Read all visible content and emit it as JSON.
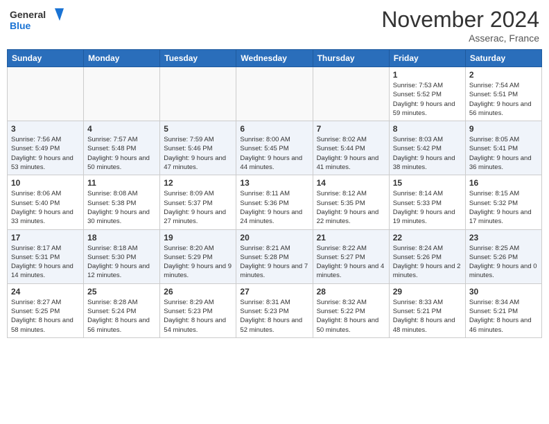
{
  "header": {
    "logo_line1": "General",
    "logo_line2": "Blue",
    "month": "November 2024",
    "location": "Asserac, France"
  },
  "weekdays": [
    "Sunday",
    "Monday",
    "Tuesday",
    "Wednesday",
    "Thursday",
    "Friday",
    "Saturday"
  ],
  "weeks": [
    [
      {
        "day": "",
        "info": ""
      },
      {
        "day": "",
        "info": ""
      },
      {
        "day": "",
        "info": ""
      },
      {
        "day": "",
        "info": ""
      },
      {
        "day": "",
        "info": ""
      },
      {
        "day": "1",
        "info": "Sunrise: 7:53 AM\nSunset: 5:52 PM\nDaylight: 9 hours and 59 minutes."
      },
      {
        "day": "2",
        "info": "Sunrise: 7:54 AM\nSunset: 5:51 PM\nDaylight: 9 hours and 56 minutes."
      }
    ],
    [
      {
        "day": "3",
        "info": "Sunrise: 7:56 AM\nSunset: 5:49 PM\nDaylight: 9 hours and 53 minutes."
      },
      {
        "day": "4",
        "info": "Sunrise: 7:57 AM\nSunset: 5:48 PM\nDaylight: 9 hours and 50 minutes."
      },
      {
        "day": "5",
        "info": "Sunrise: 7:59 AM\nSunset: 5:46 PM\nDaylight: 9 hours and 47 minutes."
      },
      {
        "day": "6",
        "info": "Sunrise: 8:00 AM\nSunset: 5:45 PM\nDaylight: 9 hours and 44 minutes."
      },
      {
        "day": "7",
        "info": "Sunrise: 8:02 AM\nSunset: 5:44 PM\nDaylight: 9 hours and 41 minutes."
      },
      {
        "day": "8",
        "info": "Sunrise: 8:03 AM\nSunset: 5:42 PM\nDaylight: 9 hours and 38 minutes."
      },
      {
        "day": "9",
        "info": "Sunrise: 8:05 AM\nSunset: 5:41 PM\nDaylight: 9 hours and 36 minutes."
      }
    ],
    [
      {
        "day": "10",
        "info": "Sunrise: 8:06 AM\nSunset: 5:40 PM\nDaylight: 9 hours and 33 minutes."
      },
      {
        "day": "11",
        "info": "Sunrise: 8:08 AM\nSunset: 5:38 PM\nDaylight: 9 hours and 30 minutes."
      },
      {
        "day": "12",
        "info": "Sunrise: 8:09 AM\nSunset: 5:37 PM\nDaylight: 9 hours and 27 minutes."
      },
      {
        "day": "13",
        "info": "Sunrise: 8:11 AM\nSunset: 5:36 PM\nDaylight: 9 hours and 24 minutes."
      },
      {
        "day": "14",
        "info": "Sunrise: 8:12 AM\nSunset: 5:35 PM\nDaylight: 9 hours and 22 minutes."
      },
      {
        "day": "15",
        "info": "Sunrise: 8:14 AM\nSunset: 5:33 PM\nDaylight: 9 hours and 19 minutes."
      },
      {
        "day": "16",
        "info": "Sunrise: 8:15 AM\nSunset: 5:32 PM\nDaylight: 9 hours and 17 minutes."
      }
    ],
    [
      {
        "day": "17",
        "info": "Sunrise: 8:17 AM\nSunset: 5:31 PM\nDaylight: 9 hours and 14 minutes."
      },
      {
        "day": "18",
        "info": "Sunrise: 8:18 AM\nSunset: 5:30 PM\nDaylight: 9 hours and 12 minutes."
      },
      {
        "day": "19",
        "info": "Sunrise: 8:20 AM\nSunset: 5:29 PM\nDaylight: 9 hours and 9 minutes."
      },
      {
        "day": "20",
        "info": "Sunrise: 8:21 AM\nSunset: 5:28 PM\nDaylight: 9 hours and 7 minutes."
      },
      {
        "day": "21",
        "info": "Sunrise: 8:22 AM\nSunset: 5:27 PM\nDaylight: 9 hours and 4 minutes."
      },
      {
        "day": "22",
        "info": "Sunrise: 8:24 AM\nSunset: 5:26 PM\nDaylight: 9 hours and 2 minutes."
      },
      {
        "day": "23",
        "info": "Sunrise: 8:25 AM\nSunset: 5:26 PM\nDaylight: 9 hours and 0 minutes."
      }
    ],
    [
      {
        "day": "24",
        "info": "Sunrise: 8:27 AM\nSunset: 5:25 PM\nDaylight: 8 hours and 58 minutes."
      },
      {
        "day": "25",
        "info": "Sunrise: 8:28 AM\nSunset: 5:24 PM\nDaylight: 8 hours and 56 minutes."
      },
      {
        "day": "26",
        "info": "Sunrise: 8:29 AM\nSunset: 5:23 PM\nDaylight: 8 hours and 54 minutes."
      },
      {
        "day": "27",
        "info": "Sunrise: 8:31 AM\nSunset: 5:23 PM\nDaylight: 8 hours and 52 minutes."
      },
      {
        "day": "28",
        "info": "Sunrise: 8:32 AM\nSunset: 5:22 PM\nDaylight: 8 hours and 50 minutes."
      },
      {
        "day": "29",
        "info": "Sunrise: 8:33 AM\nSunset: 5:21 PM\nDaylight: 8 hours and 48 minutes."
      },
      {
        "day": "30",
        "info": "Sunrise: 8:34 AM\nSunset: 5:21 PM\nDaylight: 8 hours and 46 minutes."
      }
    ]
  ]
}
